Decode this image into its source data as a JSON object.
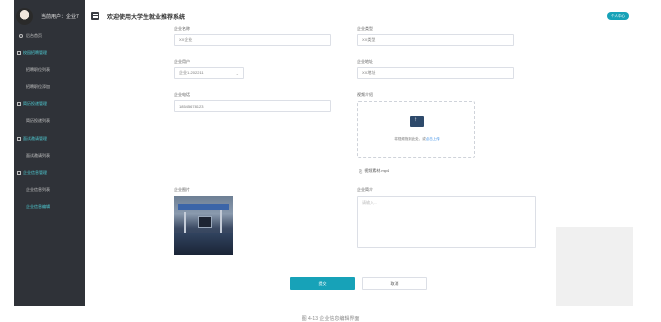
{
  "sidebar": {
    "user_label": "当前用户：企业7",
    "items": [
      {
        "label": "后台首页"
      },
      {
        "label": "校园招聘管理"
      },
      {
        "label": "招聘职位列表"
      },
      {
        "label": "招聘职位添加"
      },
      {
        "label": "简历投递管理"
      },
      {
        "label": "简历投递列表"
      },
      {
        "label": "面试邀请管理"
      },
      {
        "label": "面试邀请列表"
      },
      {
        "label": "企业信息管理"
      },
      {
        "label": "企业信息列表"
      },
      {
        "label": "企业信息编辑"
      }
    ]
  },
  "header": {
    "title": "欢迎使用大学生就业推荐系统",
    "personal_button": "个人中心"
  },
  "form": {
    "company_name": {
      "label": "企业名称",
      "value": "XX企业"
    },
    "company_type": {
      "label": "企业类型",
      "value": "XX类型"
    },
    "company_user": {
      "label": "企业用户",
      "value": "企业1-202211"
    },
    "company_address": {
      "label": "企业地址",
      "value": "XX地址"
    },
    "company_phone": {
      "label": "企业电话",
      "value": "18545678123"
    },
    "video_intro": {
      "label": "视频介绍",
      "upload_text": "将视频拖到此处，或",
      "upload_link": "点击上传",
      "file_name": "视频素材.mp4"
    },
    "company_image": {
      "label": "企业图片"
    },
    "company_intro": {
      "label": "企业简介",
      "placeholder": "请输入..."
    },
    "submit_label": "提交",
    "cancel_label": "取消"
  },
  "caption": "图 4-13 企业信息编辑界面"
}
